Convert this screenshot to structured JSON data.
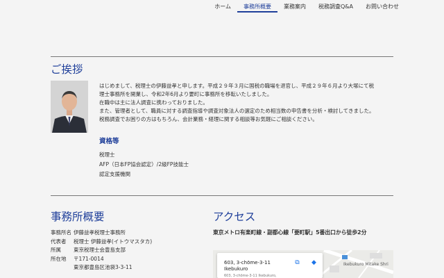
{
  "nav": {
    "items": [
      {
        "label": "ホーム"
      },
      {
        "label": "事務所概要"
      },
      {
        "label": "業務案内"
      },
      {
        "label": "税務調査Q&A"
      },
      {
        "label": "お問い合わせ"
      }
    ]
  },
  "greeting": {
    "heading": "ご挨拶",
    "paragraphs": [
      "はじめまして、税理士の伊藤益孝と申します。平成２９年３月に国税の職場を退官し、平成２９年６月より大塚にて税",
      "理士事務所を開業し、令和2年6月より要町に事務所を移転いたしました。",
      "在職中は主に法人調査に携わっておりました。",
      "また、管理者として、職員に対する調査指導や調査対象法人の選定のため相当数の申告書を分析・検討してきました。",
      "税務調査でお困りの方はもちろん、会計業務・経理に関する相談等お気軽にご相談ください。"
    ]
  },
  "qualifications": {
    "heading": "資格等",
    "items": [
      "税理士",
      "AFP（日本FP協会認定）/2級FP技能士",
      "認定支援機関"
    ]
  },
  "office": {
    "heading": "事務所概要",
    "rows": [
      {
        "key": "事務所名",
        "value": "伊藤益孝税理士事務所"
      },
      {
        "key": "代表者",
        "value": "税理士 伊藤益孝(イトウマスタカ)"
      },
      {
        "key": "所属",
        "value": "東京税理士会豊島支部"
      },
      {
        "key": "所在地",
        "value": "〒171-0014"
      },
      {
        "key": "",
        "value": "東京都豊島区池袋3-3-11"
      }
    ]
  },
  "access": {
    "heading": "アクセス",
    "subheading": "東京メトロ有楽町線・副都心線「要町駅」5番出口から徒歩2分",
    "map": {
      "title_line1": "603, 3-chōme-3-11",
      "title_line2": "Ikebukuro",
      "address": "603, 3-chōme-3-11 Ikebukuro,",
      "poi_label": "Ikebukuro Mitake Shri"
    }
  }
}
